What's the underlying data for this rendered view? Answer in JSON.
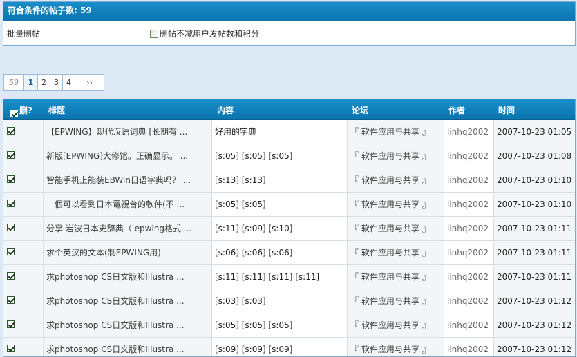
{
  "top": {
    "header": "符合条件的帖子数: 59",
    "label": "批量删帖",
    "option": "删帖不减用户发帖数和积分"
  },
  "pager": {
    "count": "59",
    "pages": [
      "1",
      "2",
      "3",
      "4"
    ],
    "next": "››"
  },
  "table": {
    "headers": {
      "check": "删?",
      "title": "标题",
      "content": "内容",
      "forum": "论坛",
      "author": "作者",
      "time": "时间"
    },
    "rows": [
      {
        "title": "【EPWING】现代汉语词典 [长期有 ...",
        "content": "好用的字典",
        "forum": "『 软件应用与共享 』",
        "author": "linhq2002",
        "time": "2007-10-23 01:05"
      },
      {
        "title": "新版[EPWING]大修馆。正确显示。 ...",
        "content": "[s:05] [s:05] [s:05]",
        "forum": "『 软件应用与共享 』",
        "author": "linhq2002",
        "time": "2007-10-23 01:08"
      },
      {
        "title": "智能手机上能装EBWin日语字典吗？ ...",
        "content": "[s:13] [s:13]",
        "forum": "『 软件应用与共享 』",
        "author": "linhq2002",
        "time": "2007-10-23 01:10"
      },
      {
        "title": "一個可以看到日本電視台的軟件(不 ...",
        "content": "[s:05] [s:05]",
        "forum": "『 软件应用与共享 』",
        "author": "linhq2002",
        "time": "2007-10-23 01:10"
      },
      {
        "title": "分享 岩波日本史辞典（ epwing格式 ...",
        "content": "[s:11] [s:09] [s:10]",
        "forum": "『 软件应用与共享 』",
        "author": "linhq2002",
        "time": "2007-10-23 01:11"
      },
      {
        "title": "求个英汉的文本(制EPWING用)",
        "content": "[s:06] [s:06] [s:06]",
        "forum": "『 软件应用与共享 』",
        "author": "linhq2002",
        "time": "2007-10-23 01:11"
      },
      {
        "title": "求photoshop CS日文版和Illustra ...",
        "content": "[s:11] [s:11] [s:11] [s:11]",
        "forum": "『 软件应用与共享 』",
        "author": "linhq2002",
        "time": "2007-10-23 01:11"
      },
      {
        "title": "求photoshop CS日文版和Illustra ...",
        "content": "[s:03] [s:03]",
        "forum": "『 软件应用与共享 』",
        "author": "linhq2002",
        "time": "2007-10-23 01:12"
      },
      {
        "title": "求photoshop CS日文版和Illustra ...",
        "content": "[s:05] [s:05] [s:05]",
        "forum": "『 软件应用与共享 』",
        "author": "linhq2002",
        "time": "2007-10-23 01:12"
      },
      {
        "title": "求photoshop CS日文版和Illustra ...",
        "content": "[s:09] [s:09] [s:09]",
        "forum": "『 软件应用与共享 』",
        "author": "linhq2002",
        "time": "2007-10-23 01:12"
      }
    ]
  }
}
